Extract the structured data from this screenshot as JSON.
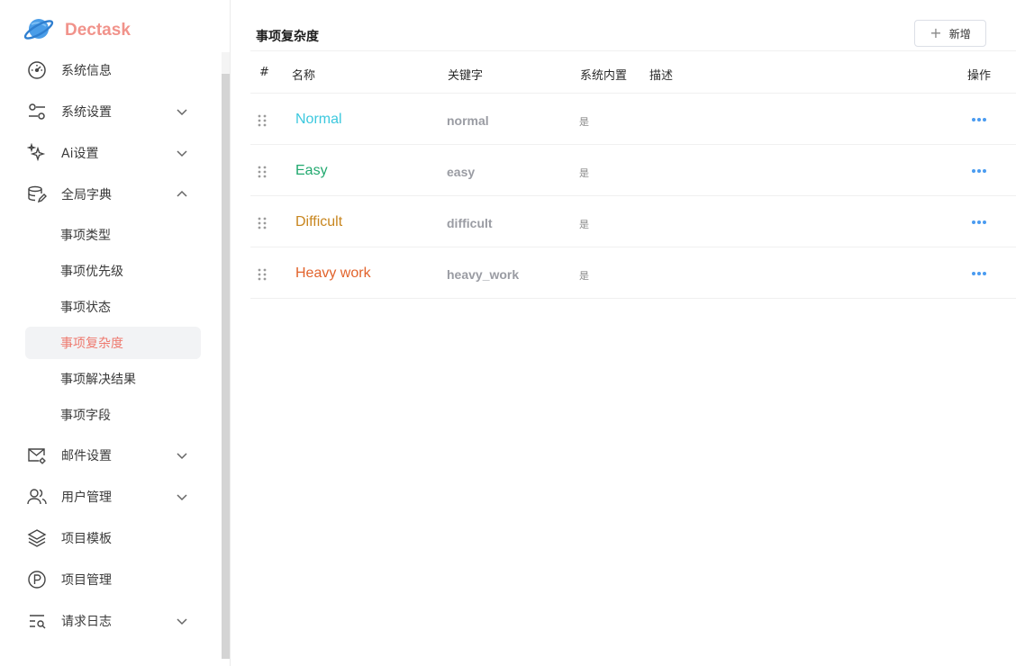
{
  "app": {
    "title": "Dectask"
  },
  "sidebar": {
    "items": [
      {
        "label": "系统信息"
      },
      {
        "label": "系统设置"
      },
      {
        "label": "Ai设置"
      },
      {
        "label": "全局字典"
      },
      {
        "label": "邮件设置"
      },
      {
        "label": "用户管理"
      },
      {
        "label": "项目模板"
      },
      {
        "label": "项目管理"
      },
      {
        "label": "请求日志"
      }
    ],
    "dict_sub": [
      {
        "label": "事项类型"
      },
      {
        "label": "事项优先级"
      },
      {
        "label": "事项状态"
      },
      {
        "label": "事项复杂度",
        "active": true
      },
      {
        "label": "事项解决结果"
      },
      {
        "label": "事项字段"
      }
    ]
  },
  "page": {
    "title": "事项复杂度",
    "add_label": "新增"
  },
  "table": {
    "headers": {
      "index": "#",
      "name": "名称",
      "key": "关键字",
      "builtin": "系统内置",
      "desc": "描述",
      "ops": "操作"
    },
    "rows": [
      {
        "name": "Normal",
        "key": "normal",
        "builtin": "是",
        "color": "#3cc8de"
      },
      {
        "name": "Easy",
        "key": "easy",
        "builtin": "是",
        "color": "#22a96f"
      },
      {
        "name": "Difficult",
        "key": "difficult",
        "builtin": "是",
        "color": "#c8861f"
      },
      {
        "name": "Heavy work",
        "key": "heavy_work",
        "builtin": "是",
        "color": "#e2632c"
      }
    ]
  },
  "colors": {
    "brand": "#f1938b",
    "active_text": "#ee7a6f",
    "more_icon": "#4a9bf0"
  }
}
